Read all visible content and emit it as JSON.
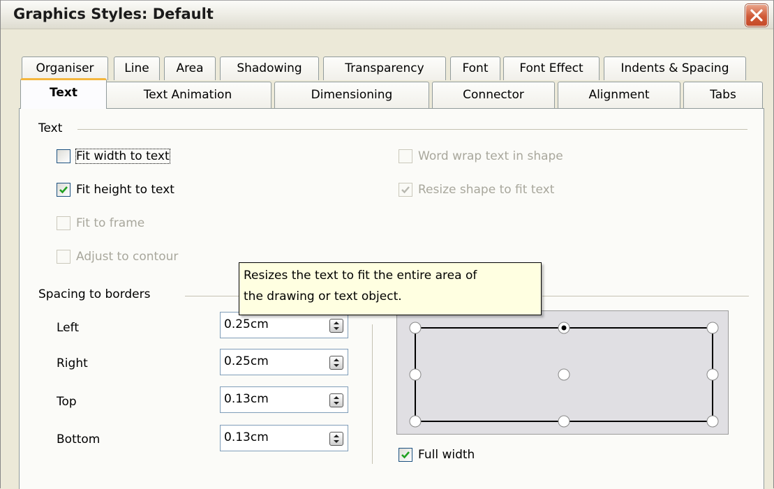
{
  "window": {
    "title": "Graphics Styles: Default"
  },
  "tabs_row1": [
    "Organiser",
    "Line",
    "Area",
    "Shadowing",
    "Transparency",
    "Font",
    "Font Effect",
    "Indents & Spacing"
  ],
  "tabs_row2": [
    "Text",
    "Text Animation",
    "Dimensioning",
    "Connector",
    "Alignment",
    "Tabs"
  ],
  "active_tab": "Text",
  "text_group": {
    "label": "Text",
    "fit_width": {
      "label": "Fit width to text",
      "checked": false,
      "enabled": true
    },
    "fit_height": {
      "label": "Fit height to text",
      "checked": true,
      "enabled": true
    },
    "fit_frame": {
      "label": "Fit to frame",
      "checked": false,
      "enabled": false
    },
    "adjust_contour": {
      "label": "Adjust to contour",
      "checked": false,
      "enabled": false
    },
    "word_wrap": {
      "label": "Word wrap text in shape",
      "checked": false,
      "enabled": false
    },
    "resize_shape": {
      "label": "Resize shape to fit text",
      "checked": true,
      "enabled": false
    }
  },
  "spacing_group": {
    "label": "Spacing to borders",
    "left": {
      "label": "Left",
      "value": "0.25cm"
    },
    "right": {
      "label": "Right",
      "value": "0.25cm"
    },
    "top": {
      "label": "Top",
      "value": "0.13cm"
    },
    "bottom": {
      "label": "Bottom",
      "value": "0.13cm"
    }
  },
  "tooltip": {
    "line1": "Resizes the text to fit the entire area of",
    "line2": "the drawing or text object."
  },
  "anchor": {
    "selected": "top-center",
    "full_width": {
      "label": "Full width",
      "checked": true
    }
  },
  "colors": {
    "active_tab_accent": "#f4b63c",
    "close_button": "#d05a37",
    "tooltip_bg": "#ffffe1",
    "checkbox_tick": "#21a121"
  }
}
